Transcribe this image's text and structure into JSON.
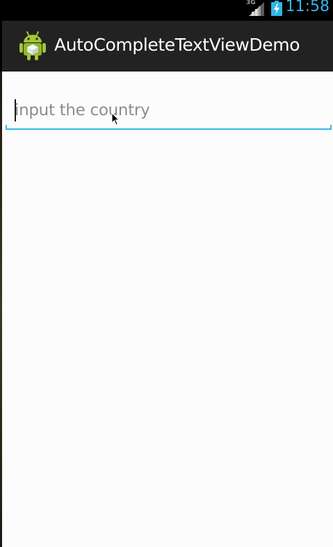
{
  "status_bar": {
    "network_type": "3G",
    "time": "11:58",
    "icons": [
      "signal-icon",
      "battery-charging-icon"
    ],
    "accent_color": "#33b5e5"
  },
  "action_bar": {
    "title": "AutoCompleteTextViewDemo",
    "icon": "android-app-icon"
  },
  "form": {
    "country_input": {
      "value": "",
      "placeholder": "input the country"
    }
  },
  "colors": {
    "action_bar_bg": "#222222",
    "content_bg": "#fcfcfc",
    "input_underline": "#33b5e5"
  }
}
